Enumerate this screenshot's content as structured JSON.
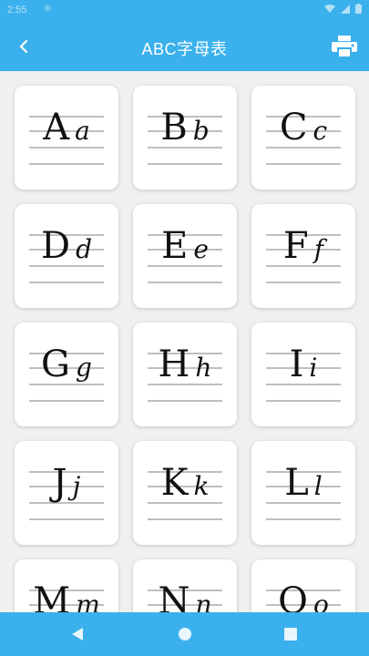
{
  "status_bar": {
    "time": "2:55",
    "extra": "⊕"
  },
  "app_bar": {
    "title": "ABC字母表",
    "back_icon": "back-arrow-icon",
    "print_icon": "printer-icon"
  },
  "letters": [
    {
      "upper": "A",
      "lower": "a"
    },
    {
      "upper": "B",
      "lower": "b"
    },
    {
      "upper": "C",
      "lower": "c"
    },
    {
      "upper": "D",
      "lower": "d"
    },
    {
      "upper": "E",
      "lower": "e"
    },
    {
      "upper": "F",
      "lower": "f"
    },
    {
      "upper": "G",
      "lower": "g"
    },
    {
      "upper": "H",
      "lower": "h"
    },
    {
      "upper": "I",
      "lower": "i"
    },
    {
      "upper": "J",
      "lower": "j"
    },
    {
      "upper": "K",
      "lower": "k"
    },
    {
      "upper": "L",
      "lower": "l"
    },
    {
      "upper": "M",
      "lower": "m"
    },
    {
      "upper": "N",
      "lower": "n"
    },
    {
      "upper": "O",
      "lower": "o"
    }
  ],
  "nav_bar": {
    "back": "triangle-back-icon",
    "home": "circle-home-icon",
    "recents": "square-recents-icon"
  },
  "colors": {
    "primary": "#3ab0ec",
    "card": "#ffffff",
    "background": "#f0f0f0"
  }
}
